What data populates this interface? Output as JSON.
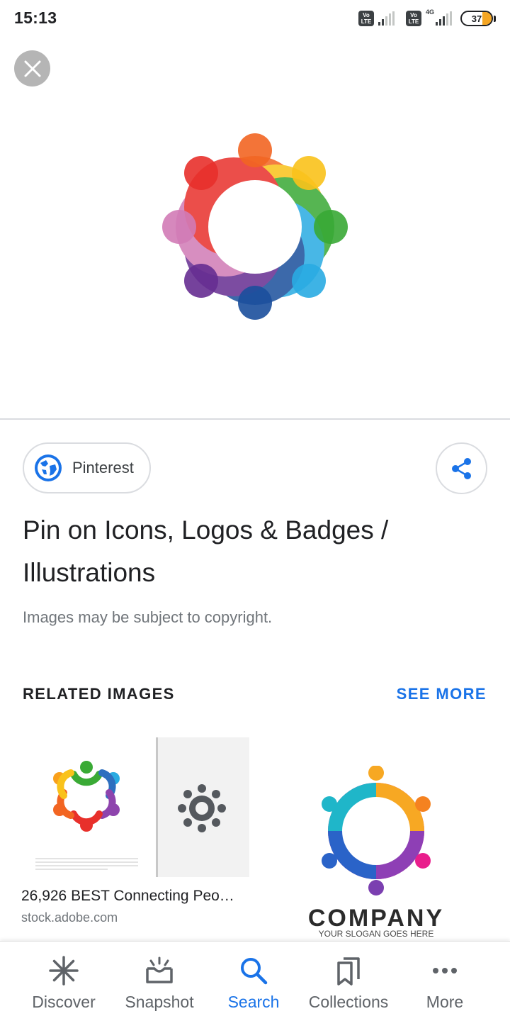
{
  "status_bar": {
    "time": "15:13",
    "sim_badge": "Vo LTE",
    "network_type": "4G",
    "battery_level": "37"
  },
  "viewer": {
    "close_icon": "close-icon",
    "image_subject": "colorful people circle logo"
  },
  "source": {
    "name": "Pinterest",
    "icon": "globe-icon",
    "share_icon": "share-icon"
  },
  "title": "Pin on Icons, Logos & Badges / Illustrations",
  "copyright_notice": "Images may be subject to copyright.",
  "related": {
    "heading": "RELATED IMAGES",
    "see_more": "SEE MORE",
    "items": [
      {
        "title": "26,926 BEST Connecting Peo…",
        "domain": "stock.adobe.com"
      },
      {
        "logo_text": "COMPANY",
        "slogan": "YOUR SLOGAN GOES HERE"
      }
    ]
  },
  "bottom_nav": [
    {
      "label": "Discover",
      "icon": "asterisk-icon",
      "active": false
    },
    {
      "label": "Snapshot",
      "icon": "snapshot-icon",
      "active": false
    },
    {
      "label": "Search",
      "icon": "search-icon",
      "active": true
    },
    {
      "label": "Collections",
      "icon": "bookmarks-icon",
      "active": false
    },
    {
      "label": "More",
      "icon": "more-dots-icon",
      "active": false
    }
  ],
  "colors": {
    "accent": "#1a73e8",
    "text_primary": "#202124",
    "text_secondary": "#70757a",
    "close_button_bg": "#b5b5b5"
  }
}
